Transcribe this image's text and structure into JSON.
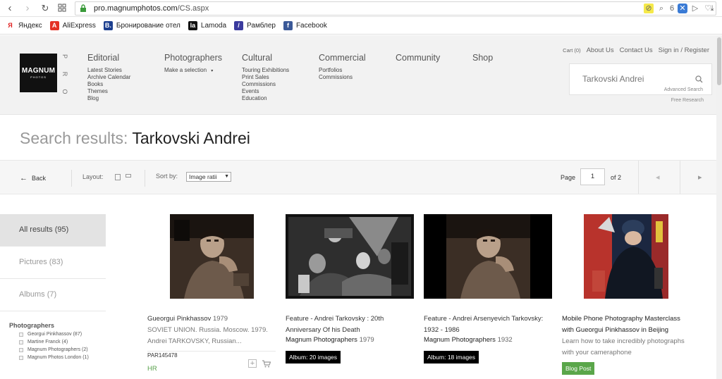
{
  "browser": {
    "url_host": "pro.magnumphotos.com",
    "url_path": "/CS.aspx",
    "badge_count": "6",
    "bookmarks": [
      {
        "label": "Яндекс",
        "icon": "yandex-icon",
        "color": "#ffffff",
        "glyph": "Я"
      },
      {
        "label": "AliExpress",
        "icon": "aliexpress-icon",
        "color": "#e43225",
        "glyph": "A"
      },
      {
        "label": "Бронирование отел",
        "icon": "booking-icon",
        "color": "#1c3f8f",
        "glyph": "B."
      },
      {
        "label": "Lamoda",
        "icon": "lamoda-icon",
        "color": "#111111",
        "glyph": "la"
      },
      {
        "label": "Рамблер",
        "icon": "rambler-icon",
        "color": "#3b3b9e",
        "glyph": "/"
      },
      {
        "label": "Facebook",
        "icon": "facebook-icon",
        "color": "#3b5998",
        "glyph": "f"
      }
    ]
  },
  "header": {
    "logo_text": "MAGNUM",
    "logo_sub": "PHOTOS",
    "pro_letters": [
      "P",
      "R",
      "O"
    ],
    "menus": [
      {
        "label": "Editorial",
        "items": [
          "Latest Stories",
          "Archive Calendar",
          "Books",
          "Themes",
          "Blog"
        ]
      },
      {
        "label": "Photographers",
        "items": [
          "Make a selection"
        ]
      },
      {
        "label": "Cultural",
        "items": [
          "Touring Exhibitions",
          "Print Sales",
          "Commissions",
          "Events",
          "Education"
        ]
      },
      {
        "label": "Commercial",
        "items": [
          "Portfolios",
          "Commissions"
        ]
      },
      {
        "label": "Community",
        "items": []
      },
      {
        "label": "Shop",
        "items": []
      }
    ],
    "util": {
      "cart": "Cart (0)",
      "about": "About Us",
      "contact": "Contact Us",
      "signin": "Sign in / Register"
    },
    "search": {
      "value": "Tarkovski Andrei",
      "advanced": "Advanced Search",
      "free": "Free Research"
    }
  },
  "page": {
    "title_label": "Search results:",
    "title_query": "Tarkovski Andrei"
  },
  "toolbar": {
    "back": "Back",
    "layout": "Layout:",
    "sort": "Sort by:",
    "sort_value": "Image ratii",
    "page": "Page",
    "page_value": "1",
    "of": "of 2"
  },
  "sidebar": {
    "tabs": [
      {
        "label": "All results (95)",
        "active": true
      },
      {
        "label": "Pictures (83)",
        "active": false
      },
      {
        "label": "Albums (7)",
        "active": false
      }
    ],
    "facet_title": "Photographers",
    "facets": [
      "Georgui Pinkhassov (87)",
      "Martine Franck (4)",
      "Magnum Photographers (2)",
      "Magnum Photos London (1)"
    ]
  },
  "results": [
    {
      "title": "Gueorgui Pinkhassov",
      "year": "1979",
      "desc": "SOVIET UNION. Russia. Moscow. 1979. Andrei TARKOVSKY, Russian...",
      "code": "PAR145478",
      "rights": "HR"
    },
    {
      "title": "Feature - Andrei Tarkovsky : 20th Anniversary Of his Death",
      "photographer": "Magnum Photographers",
      "year": "1979",
      "badge": "Album: 20 images"
    },
    {
      "title": "Feature - Andrei Arsenyevich Tarkovsky: 1932 - 1986",
      "photographer": "Magnum Photographers",
      "year": "1932",
      "badge": "Album: 18 images"
    },
    {
      "title": "Mobile Phone Photography Masterclass with Gueorgui Pinkhassov in Beijing",
      "desc": "Learn how to take incredibly photographs with your cameraphone",
      "badge": "Blog Post"
    }
  ]
}
